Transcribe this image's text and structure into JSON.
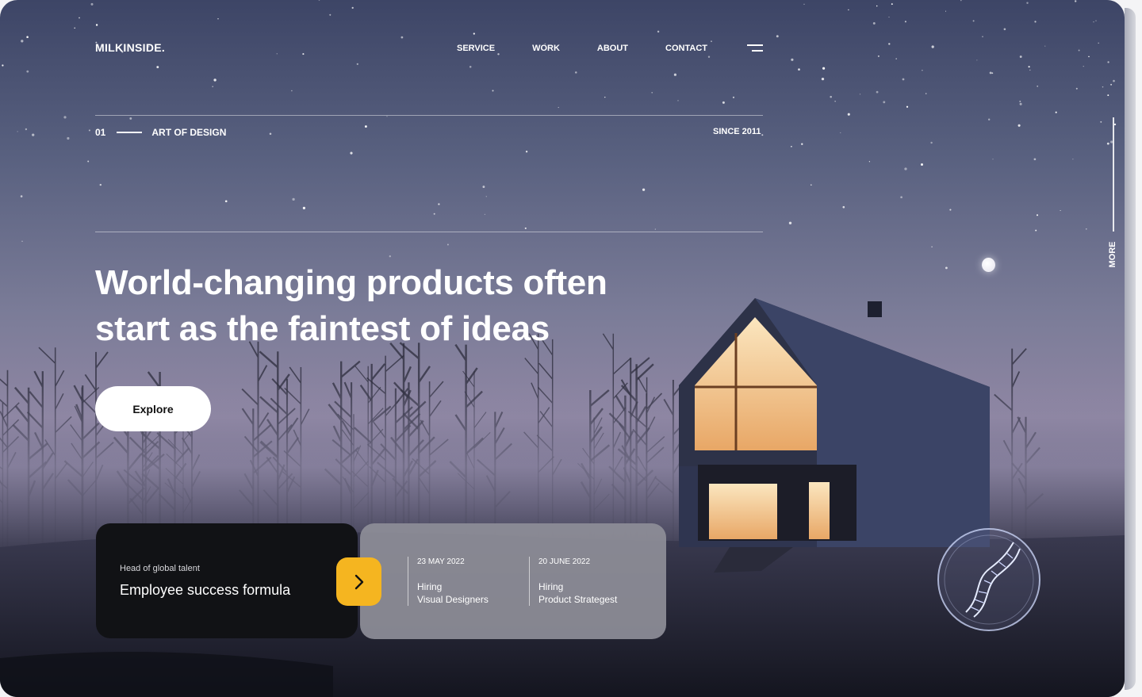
{
  "brand": {
    "logo": "MILKINSIDE."
  },
  "nav": {
    "items": [
      "SERVICE",
      "WORK",
      "ABOUT",
      "CONTACT"
    ]
  },
  "intro": {
    "index": "01",
    "label": "ART OF DESIGN",
    "since": "SINCE 2011"
  },
  "hero": {
    "headline_line1": "World-changing products often",
    "headline_line2": "start as the faintest of ideas",
    "cta": "Explore"
  },
  "side": {
    "more": "MORE"
  },
  "feature_card": {
    "subtitle": "Head of global talent",
    "title": "Employee success formula"
  },
  "jobs": [
    {
      "date": "23 MAY 2022",
      "type": "Hiring",
      "role": "Visual Designers"
    },
    {
      "date": "20 JUNE 2022",
      "type": "Hiring",
      "role": "Product Strategest"
    }
  ],
  "colors": {
    "accent": "#f5b520",
    "card_dark": "#111215",
    "sky_top": "#3d4566",
    "window_glow": "#f4d7a6"
  },
  "icons": [
    "menu-icon",
    "chevron-right-icon",
    "dna-icon",
    "moon-icon"
  ]
}
